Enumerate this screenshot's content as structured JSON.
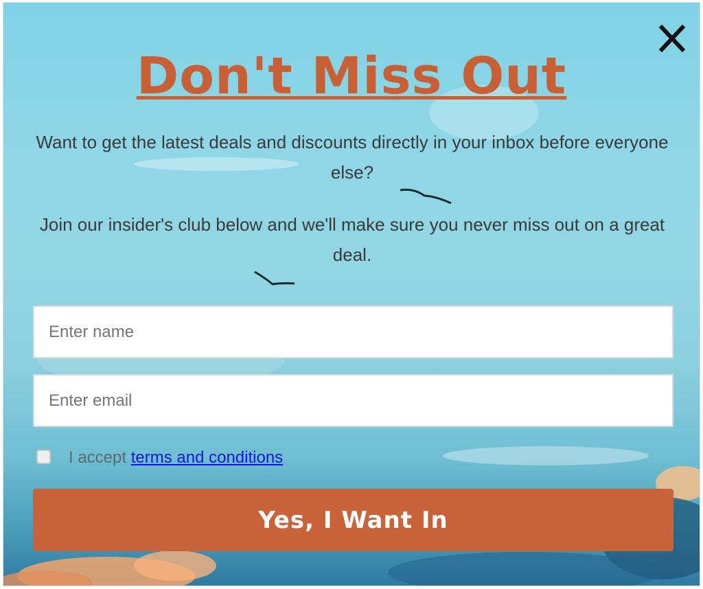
{
  "popup": {
    "title": "Don't Miss Out",
    "paragraph1": "Want to get the latest deals and discounts directly in your inbox before everyone else?",
    "paragraph2": "Join our insider's club below and we'll make sure you never miss out on a great deal.",
    "close_icon": "close-icon",
    "name_placeholder": "Enter name",
    "email_placeholder": "Enter email",
    "consent_prefix": "I accept ",
    "consent_link": "terms and conditions",
    "consent_checked": false,
    "submit_label": "Yes, I Want In"
  },
  "colors": {
    "title": "#c95f35",
    "button": "#c9643a",
    "link": "#1515d8",
    "sky": "#8fd6e6"
  }
}
